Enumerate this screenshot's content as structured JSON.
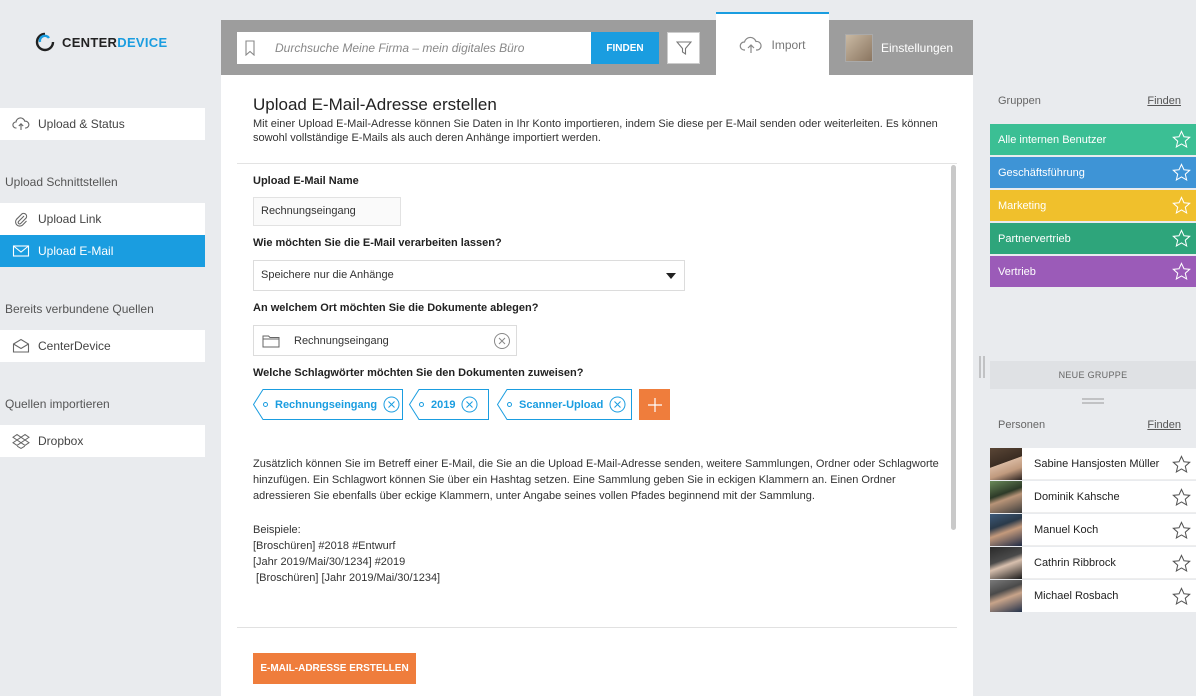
{
  "brand": {
    "name_part1": "CENTER",
    "name_part2": "DEVICE",
    "accent": "#1a9de0"
  },
  "sidebar": {
    "upload_status": "Upload & Status",
    "sections": [
      {
        "heading": "Upload Schnittstellen"
      },
      {
        "heading": "Bereits verbundene Quellen"
      },
      {
        "heading": "Quellen importieren"
      }
    ],
    "items": {
      "upload_link": "Upload Link",
      "upload_email": "Upload E-Mail",
      "centerdevice": "CenterDevice",
      "dropbox": "Dropbox"
    }
  },
  "topbar": {
    "search_placeholder": "Durchsuche Meine Firma – mein digitales Büro",
    "find_label": "FINDEN",
    "tab_import": "Import",
    "tab_settings": "Einstellungen"
  },
  "main": {
    "title": "Upload E-Mail-Adresse erstellen",
    "description": "Mit einer Upload E-Mail-Adresse können Sie Daten in Ihr Konto importieren, indem Sie diese per E-Mail senden oder weiterleiten. Es können sowohl vollständige E-Mails als auch deren Anhänge importiert werden.",
    "name_label": "Upload E-Mail Name",
    "name_value": "Rechnungseingang",
    "process_label": "Wie möchten Sie die E-Mail verarbeiten lassen?",
    "process_value": "Speichere nur die Anhänge",
    "location_label": "An welchem Ort möchten Sie die Dokumente ablegen?",
    "location_value": "Rechnungseingang",
    "tags_label": "Welche Schlagwörter möchten Sie den Dokumenten zuweisen?",
    "tags": [
      "Rechnungseingang",
      "2019",
      "Scanner-Upload"
    ],
    "info": "Zusätzlich können Sie im Betreff einer E-Mail, die Sie an die Upload E-Mail-Adresse senden, weitere Sammlungen, Ordner oder Schlagworte hinzufügen. Ein Schlagwort können Sie über ein Hashtag setzen. Eine Sammlung geben Sie in eckigen Klammern an. Einen Ordner adressieren Sie ebenfalls über eckige Klammern, unter Angabe seines vollen Pfades beginnend mit der Sammlung.",
    "examples_heading": "Beispiele:",
    "examples": [
      "[Broschüren] #2018 #Entwurf",
      "[Jahr 2019/Mai/30/1234] #2019",
      " [Broschüren] [Jahr 2019/Mai/30/1234]"
    ],
    "create_button": "E-MAIL-ADRESSE ERSTELLEN",
    "orange": "#ef7d3c"
  },
  "right": {
    "groups_heading": "Gruppen",
    "find_label": "Finden",
    "groups": [
      {
        "name": "Alle internen Benutzer",
        "color": "#3bbf94"
      },
      {
        "name": "Geschäftsführung",
        "color": "#3e94d6"
      },
      {
        "name": "Marketing",
        "color": "#f0c02c"
      },
      {
        "name": "Partnervertrieb",
        "color": "#2ea57b"
      },
      {
        "name": "Vertrieb",
        "color": "#9b5bb8"
      }
    ],
    "new_group": "NEUE GRUPPE",
    "persons_heading": "Personen",
    "persons": [
      {
        "name": "Sabine Hansjosten Müller"
      },
      {
        "name": "Dominik Kahsche"
      },
      {
        "name": "Manuel Koch"
      },
      {
        "name": "Cathrin Ribbrock"
      },
      {
        "name": "Michael Rosbach"
      }
    ]
  }
}
